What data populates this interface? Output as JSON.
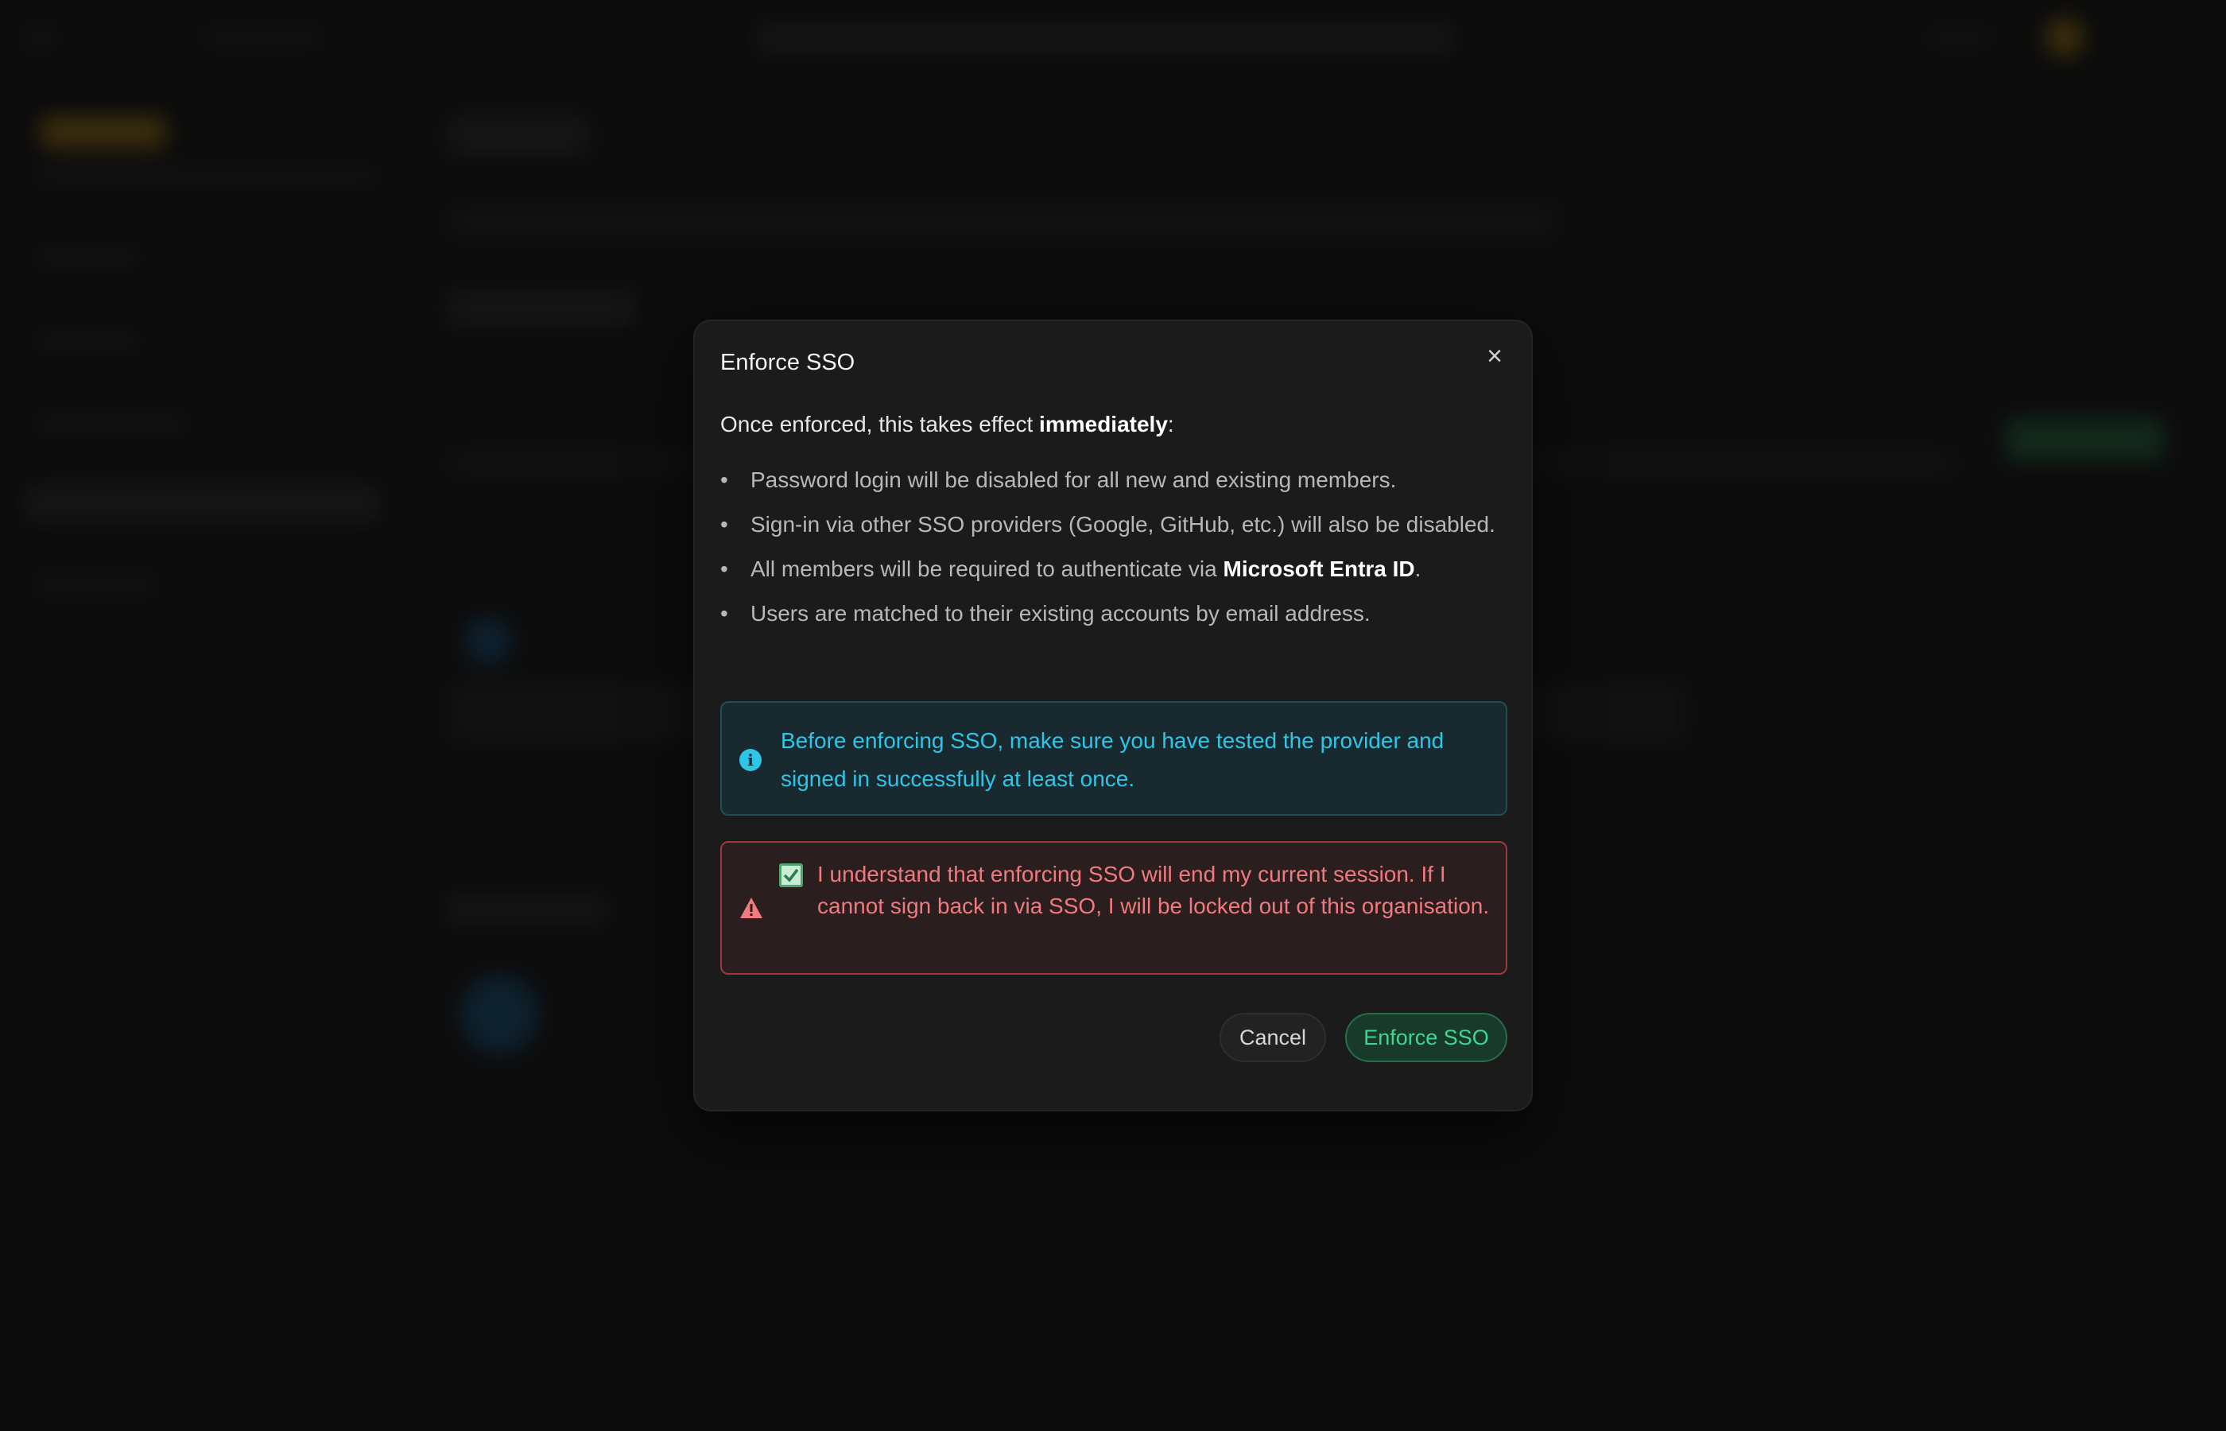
{
  "modal": {
    "title": "Enforce SSO",
    "close_icon": "close-icon",
    "intro_prefix": "Once enforced, this takes effect ",
    "intro_emphasis": "immediately",
    "intro_suffix": ":",
    "points": [
      {
        "text": "Password login will be disabled for all new and existing members."
      },
      {
        "text": "Sign-in via other SSO providers (Google, GitHub, etc.) will also be disabled."
      },
      {
        "prefix": "All members will be required to authenticate via ",
        "emphasis": "Microsoft Entra ID",
        "suffix": "."
      },
      {
        "text": "Users are matched to their existing accounts by email address."
      }
    ],
    "info": {
      "icon": "info-icon",
      "text": "Before enforcing SSO, make sure you have tested the provider and signed in successfully at least once."
    },
    "warning": {
      "icon": "warning-icon",
      "checked": true,
      "text": "I understand that enforcing SSO will end my current session. If I cannot sign back in via SSO, I will be locked out of this organisation."
    },
    "actions": {
      "cancel_label": "Cancel",
      "confirm_label": "Enforce SSO"
    }
  },
  "colors": {
    "info_accent": "#2ec6e6",
    "warning_accent": "#f07a7e",
    "confirm_accent": "#3fd68f",
    "modal_background": "#1b1b1b"
  }
}
